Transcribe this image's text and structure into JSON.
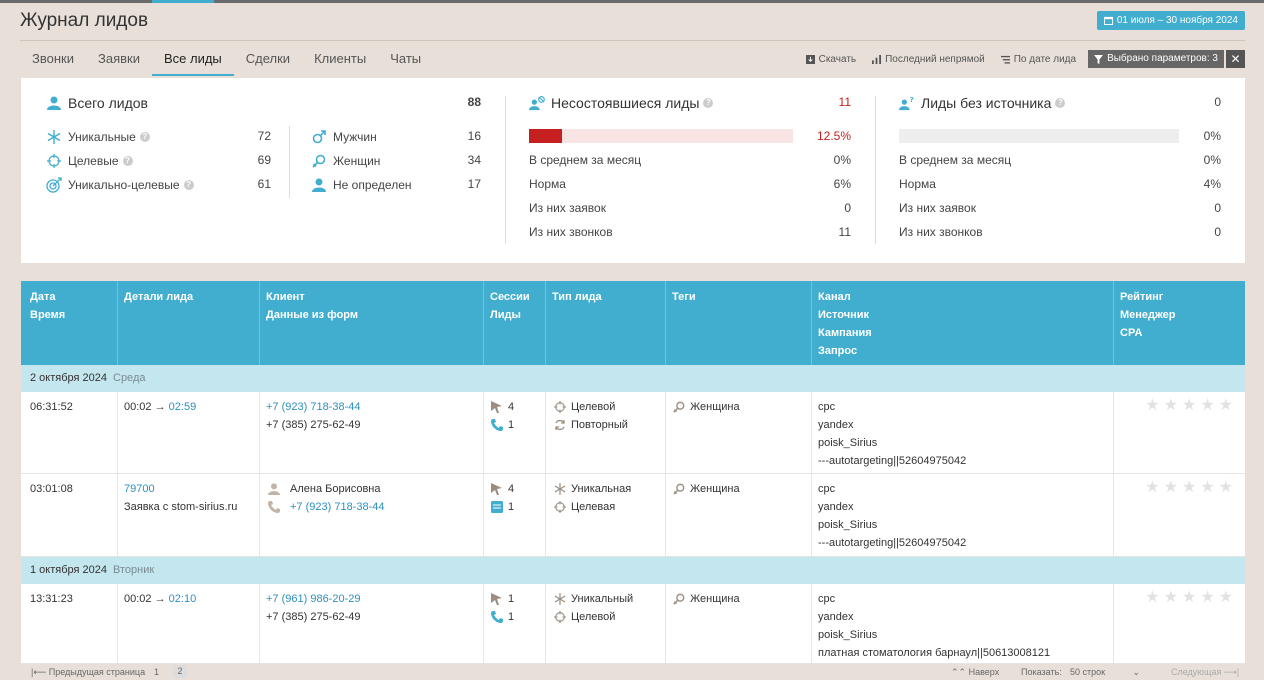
{
  "title": "Журнал лидов",
  "date_range": "01 июля – 30 ноября 2024",
  "tabs": [
    "Звонки",
    "Заявки",
    "Все лиды",
    "Сделки",
    "Клиенты",
    "Чаты"
  ],
  "active_tab": "Все лиды",
  "tools": {
    "download": "Скачать",
    "last_indirect": "Последний непрямой",
    "by_date": "По дате лида",
    "params": "Выбрано параметров: 3",
    "close": "✕"
  },
  "accent_color": "#41aecf",
  "stats": {
    "total": {
      "label": "Всего лидов",
      "value": "88"
    },
    "left": [
      {
        "label": "Уникальные",
        "value": "72",
        "icon": "asterisk-icon"
      },
      {
        "label": "Целевые",
        "value": "69",
        "icon": "target-icon"
      },
      {
        "label": "Уникально-целевые",
        "value": "61",
        "icon": "bullseye-icon"
      }
    ],
    "gender": [
      {
        "label": "Мужчин",
        "value": "16",
        "icon": "male-icon"
      },
      {
        "label": "Женщин",
        "value": "34",
        "icon": "female-icon"
      },
      {
        "label": "Не определен",
        "value": "17",
        "icon": "person-icon"
      }
    ],
    "failed": {
      "label": "Несостоявшиеся лиды",
      "value": "11",
      "percent": "12.5%",
      "fill": 0.125,
      "rows": [
        {
          "label": "В среднем за месяц",
          "value": "0%"
        },
        {
          "label": "Норма",
          "value": "6%"
        },
        {
          "label": "Из них заявок",
          "value": "0"
        },
        {
          "label": "Из них звонков",
          "value": "11"
        }
      ]
    },
    "nosource": {
      "label": "Лиды без источника",
      "value": "0",
      "percent": "0%",
      "fill": 0,
      "rows": [
        {
          "label": "В среднем за месяц",
          "value": "0%"
        },
        {
          "label": "Норма",
          "value": "4%"
        },
        {
          "label": "Из них заявок",
          "value": "0"
        },
        {
          "label": "Из них звонков",
          "value": "0"
        }
      ]
    }
  },
  "table": {
    "headers": [
      [
        "Дата",
        "Время"
      ],
      [
        "Детали лида"
      ],
      [
        "Клиент",
        "Данные из форм"
      ],
      [
        "Сессии",
        "Лиды"
      ],
      [
        "Тип лида"
      ],
      [
        "Теги"
      ],
      [
        "Канал",
        "Источник",
        "Кампания",
        "Запрос"
      ],
      [
        "Рейтинг",
        "Менеджер",
        "CPA"
      ]
    ],
    "groups": [
      {
        "date": "2 октября 2024",
        "weekday": "Среда"
      },
      {
        "date": "1 октября 2024",
        "weekday": "Вторник"
      }
    ],
    "rows": [
      {
        "time": "06:31:52",
        "details_a": "00:02 →",
        "details_b": "02:59",
        "client_phone": "+7 (923) 718-38-44",
        "client_second": "+7 (385) 275-62-49",
        "sessions": "4",
        "leads": "1",
        "type1": "Целевой",
        "type2": "Повторный",
        "tag": "Женщина",
        "channel": [
          "cpc",
          "yandex",
          "poisk_Sirius",
          "---autotargeting||52604975042"
        ]
      },
      {
        "time": "03:01:08",
        "details_a": "79700",
        "details_b": "Заявка с stom-sirius.ru",
        "client_name": "Алена Борисовна",
        "client_phone": "+7 (923) 718-38-44",
        "sessions": "4",
        "leads": "1",
        "type1": "Уникальная",
        "type2": "Целевая",
        "tag": "Женщина",
        "channel": [
          "cpc",
          "yandex",
          "poisk_Sirius",
          "---autotargeting||52604975042"
        ]
      },
      {
        "time": "13:31:23",
        "details_a": "00:02 →",
        "details_b": "02:10",
        "client_phone": "+7 (961) 986-20-29",
        "client_second": "+7 (385) 275-62-49",
        "sessions": "1",
        "leads": "1",
        "type1": "Уникальный",
        "type2": "Целевой",
        "tag": "Женщина",
        "channel": [
          "cpc",
          "yandex",
          "poisk_Sirius",
          "платная стоматология барнаул||50613008121"
        ]
      }
    ]
  },
  "footer": {
    "prev": "Предыдущая страница",
    "pages": [
      "1",
      "2"
    ],
    "up": "Наверх",
    "show_label": "Показать:",
    "show_value": "50 строк",
    "next": "Следующая"
  }
}
